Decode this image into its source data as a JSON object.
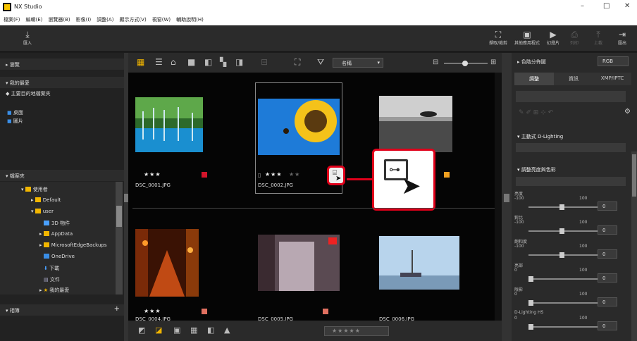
{
  "window": {
    "title": "NX Studio",
    "minimize": "–",
    "maximize": "□",
    "close": "✕"
  },
  "menu": [
    "檔案(F)",
    "編輯(E)",
    "瀏覽器(B)",
    "影像(I)",
    "調整(A)",
    "顯示方式(V)",
    "視窗(W)",
    "輔助說明(H)"
  ],
  "toolbar": {
    "import": "匯入",
    "crop": "擷取/裁剪",
    "other_apps": "其他應用程式",
    "slideshow": "幻燈片",
    "print": "列印",
    "upload": "上載",
    "export": "匯出"
  },
  "left": {
    "browse": "瀏覽",
    "favorites": "我的最愛",
    "main_folder": "主要目的地檔案夾",
    "desktop": "桌面",
    "pictures": "圖片",
    "folders": "檔案夾",
    "albums": "相簿",
    "tree": [
      "使用者",
      "Default",
      "user",
      "3D 物件",
      "AppData",
      "MicrosoftEdgeBackups",
      "OneDrive",
      "下載",
      "文件",
      "我的最愛"
    ]
  },
  "viewbar": {
    "sort": "名稱"
  },
  "photos": [
    {
      "name": "DSC_0001.JPG",
      "stars": "★★★",
      "empty": "",
      "label_color": "#d4142a"
    },
    {
      "name": "DSC_0002.JPG",
      "stars": "★★★",
      "empty": "★★",
      "label_color": ""
    },
    {
      "name": "",
      "stars": "",
      "empty": "",
      "label_color": "#f0a020"
    },
    {
      "name": "DSC_0004.JPG",
      "stars": "★★★",
      "empty": "",
      "label_color": "#e07060"
    },
    {
      "name": "DSC_0005.JPG",
      "stars": "",
      "empty": "",
      "label_color": "#e07060"
    },
    {
      "name": "DSC_0006.JPG",
      "stars": "",
      "empty": "",
      "label_color": ""
    }
  ],
  "bottom": {
    "rating": "★★★★★"
  },
  "right": {
    "histogram": "色階分佈圖",
    "channel": "RGB",
    "tab_adjust": "調整",
    "tab_info": "資訊",
    "tab_xmp": "XMP/IPTC",
    "active_dlighting": "主動式 D-Lighting",
    "tone": "調整亮度與色彩",
    "sliders": [
      {
        "label": "亮度",
        "min": "-100",
        "max": "100",
        "value": "0"
      },
      {
        "label": "對比",
        "min": "-100",
        "max": "100",
        "value": "0"
      },
      {
        "label": "飽和度",
        "min": "-100",
        "max": "100",
        "value": "0"
      },
      {
        "label": "亮部",
        "min": "0",
        "max": "100",
        "value": "0"
      },
      {
        "label": "陰影",
        "min": "0",
        "max": "100",
        "value": "0"
      },
      {
        "label": "D-Lighting HS",
        "min": "0",
        "max": "100",
        "value": "0"
      }
    ]
  },
  "colors": {
    "accent": "#f0b400",
    "highlight": "#e0001a",
    "panel": "#2a2a2a",
    "grid_bg": "#050505"
  }
}
